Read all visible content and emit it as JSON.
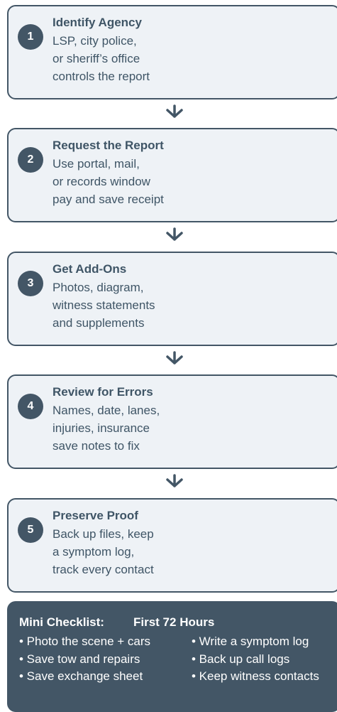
{
  "steps": [
    {
      "number": "1",
      "title": "Identify Agency",
      "lines": [
        "LSP, city police,",
        "or sheriff’s office",
        "controls the report"
      ]
    },
    {
      "number": "2",
      "title": "Request the Report",
      "lines": [
        "Use portal, mail,",
        "or records window",
        "pay and save receipt"
      ]
    },
    {
      "number": "3",
      "title": "Get Add-Ons",
      "lines": [
        "Photos, diagram,",
        "witness statements",
        "and supplements"
      ]
    },
    {
      "number": "4",
      "title": "Review for Errors",
      "lines": [
        "Names, date, lanes,",
        "injuries, insurance",
        "save notes to fix"
      ]
    },
    {
      "number": "5",
      "title": "Preserve Proof",
      "lines": [
        "Back up files, keep",
        "a symptom log,",
        "track every contact"
      ]
    }
  ],
  "checklist": {
    "title_left": "Mini Checklist:",
    "title_right": "First 72 Hours",
    "left_items": [
      "• Photo the scene + cars",
      "• Save tow and repairs",
      "• Save exchange sheet"
    ],
    "right_items": [
      "• Write a symptom log",
      "• Back up call logs",
      "• Keep witness contacts"
    ]
  },
  "colors": {
    "accent": "#435666",
    "box_fill": "#eef2f6",
    "text": "#3f5566"
  },
  "icons": {
    "connector": "arrow-down-icon"
  }
}
